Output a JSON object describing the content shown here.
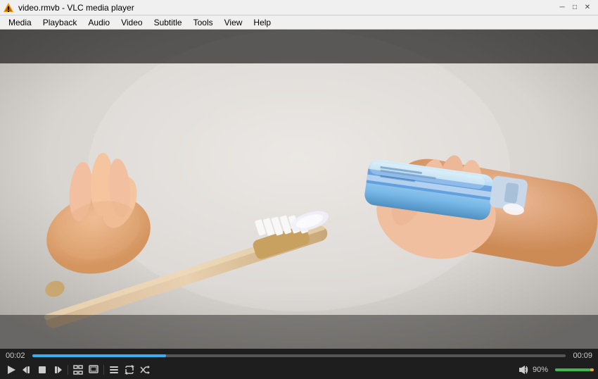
{
  "titlebar": {
    "title": "video.rmvb - VLC media player",
    "icon": "vlc"
  },
  "menubar": {
    "items": [
      "Media",
      "Playback",
      "Audio",
      "Video",
      "Subtitle",
      "Tools",
      "View",
      "Help"
    ]
  },
  "controls": {
    "time_current": "00:02",
    "time_total": "00:09",
    "volume_label": "90%",
    "seekbar_fill_percent": 25,
    "volume_fill_percent": 90
  },
  "buttons": {
    "play": "▶",
    "prev": "⏮",
    "stop": "⏹",
    "next": "⏭",
    "fullscreen": "⛶",
    "extended": "❐",
    "playlist": "☰",
    "loop": "↺",
    "random": "⇄"
  }
}
